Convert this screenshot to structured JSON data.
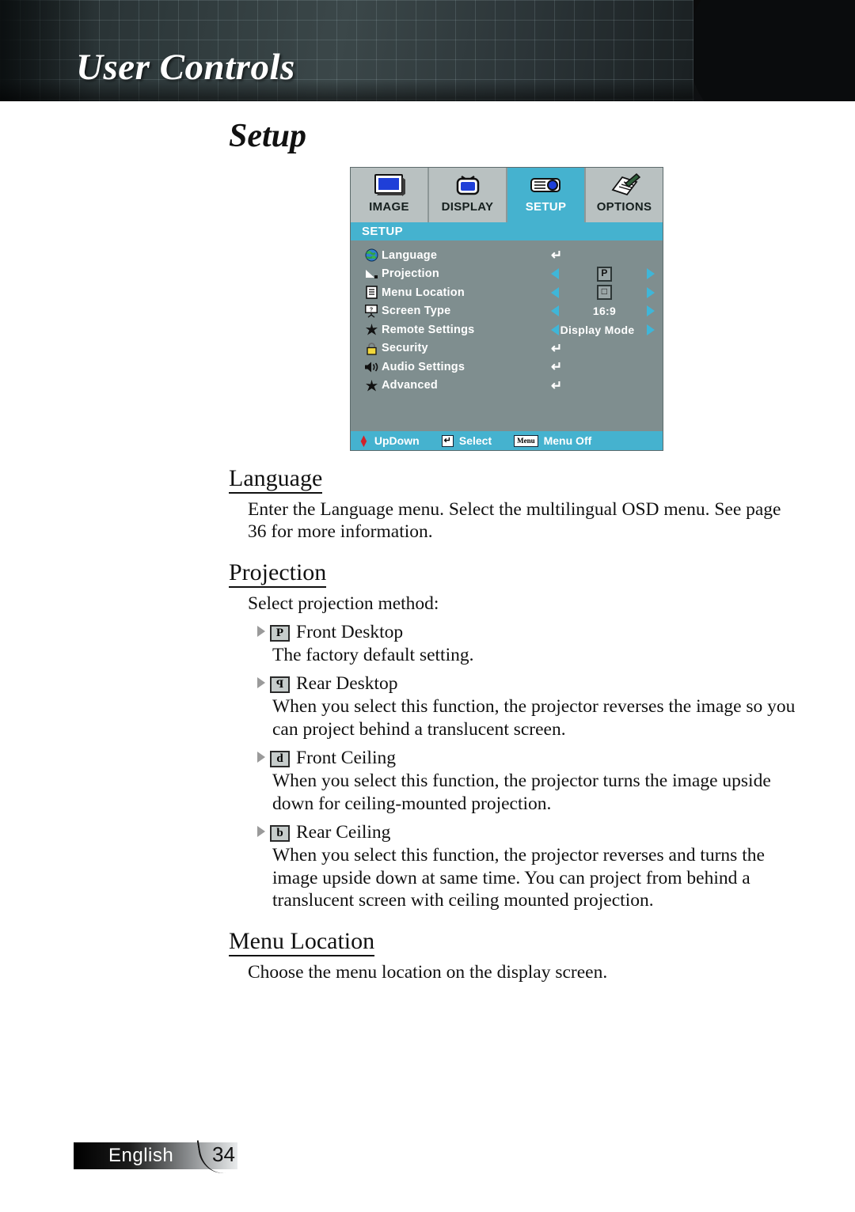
{
  "header": {
    "title": "User Controls",
    "lens_accent": "#6b4a7a"
  },
  "page_title": "Setup",
  "osd": {
    "tabs": [
      {
        "label": "IMAGE",
        "icon": "monitor-icon",
        "active": false
      },
      {
        "label": "DISPLAY",
        "icon": "tv-icon",
        "active": false
      },
      {
        "label": "SETUP",
        "icon": "projector-icon",
        "active": true
      },
      {
        "label": "OPTIONS",
        "icon": "notepad-pencil-icon",
        "active": false
      }
    ],
    "section_title": "SETUP",
    "accent_color": "#45b2cf",
    "panel_color": "#7f8e8f",
    "rows": [
      {
        "label": "Language",
        "icon": "globe-icon",
        "control": "enter",
        "value": ""
      },
      {
        "label": "Projection",
        "icon": "projection-angle-icon",
        "control": "stepper-boxed",
        "value": "P"
      },
      {
        "label": "Menu Location",
        "icon": "document-icon",
        "control": "stepper-boxed",
        "value": "□"
      },
      {
        "label": "Screen Type",
        "icon": "screen-question-icon",
        "control": "stepper",
        "value": "16:9"
      },
      {
        "label": "Remote Settings",
        "icon": "star-icon",
        "control": "stepper-wide",
        "value": "Display Mode"
      },
      {
        "label": "Security",
        "icon": "padlock-icon",
        "control": "enter",
        "value": ""
      },
      {
        "label": "Audio Settings",
        "icon": "speaker-icon",
        "control": "enter",
        "value": ""
      },
      {
        "label": "Advanced",
        "icon": "star-icon",
        "control": "enter",
        "value": ""
      }
    ],
    "status_bar": [
      {
        "key": "updown-arrows-icon",
        "label": "UpDown"
      },
      {
        "key": "enter-key-icon",
        "label": "Select"
      },
      {
        "key": "menu-key-icon",
        "label": "Menu Off"
      }
    ],
    "enter_glyph": "↵",
    "menu_key_text": "Menu"
  },
  "sections": {
    "language": {
      "heading": "Language",
      "body": "Enter the Language menu. Select the multilingual OSD menu. See page 36 for more information."
    },
    "projection": {
      "heading": "Projection",
      "intro": "Select projection method:",
      "items": [
        {
          "badge": "P",
          "badge_flip": false,
          "title": "Front Desktop",
          "body": "The factory default setting."
        },
        {
          "badge": "P",
          "badge_flip": true,
          "title": "Rear Desktop",
          "body": "When you select this function, the projector reverses the image so you can project behind a translucent screen."
        },
        {
          "badge": "d",
          "badge_flip": false,
          "title": "Front Ceiling",
          "body": "When you select this function, the projector turns the image upside down for ceiling-mounted projection."
        },
        {
          "badge": "b",
          "badge_flip": false,
          "title": "Rear Ceiling",
          "body": "When you select this function, the projector reverses and turns the image upside down at same time. You can project from behind a translucent screen with ceiling mounted projection."
        }
      ]
    },
    "menu_location": {
      "heading": "Menu Location",
      "body": "Choose the menu location on the display screen."
    }
  },
  "footer": {
    "language": "English",
    "page_number": "34"
  }
}
